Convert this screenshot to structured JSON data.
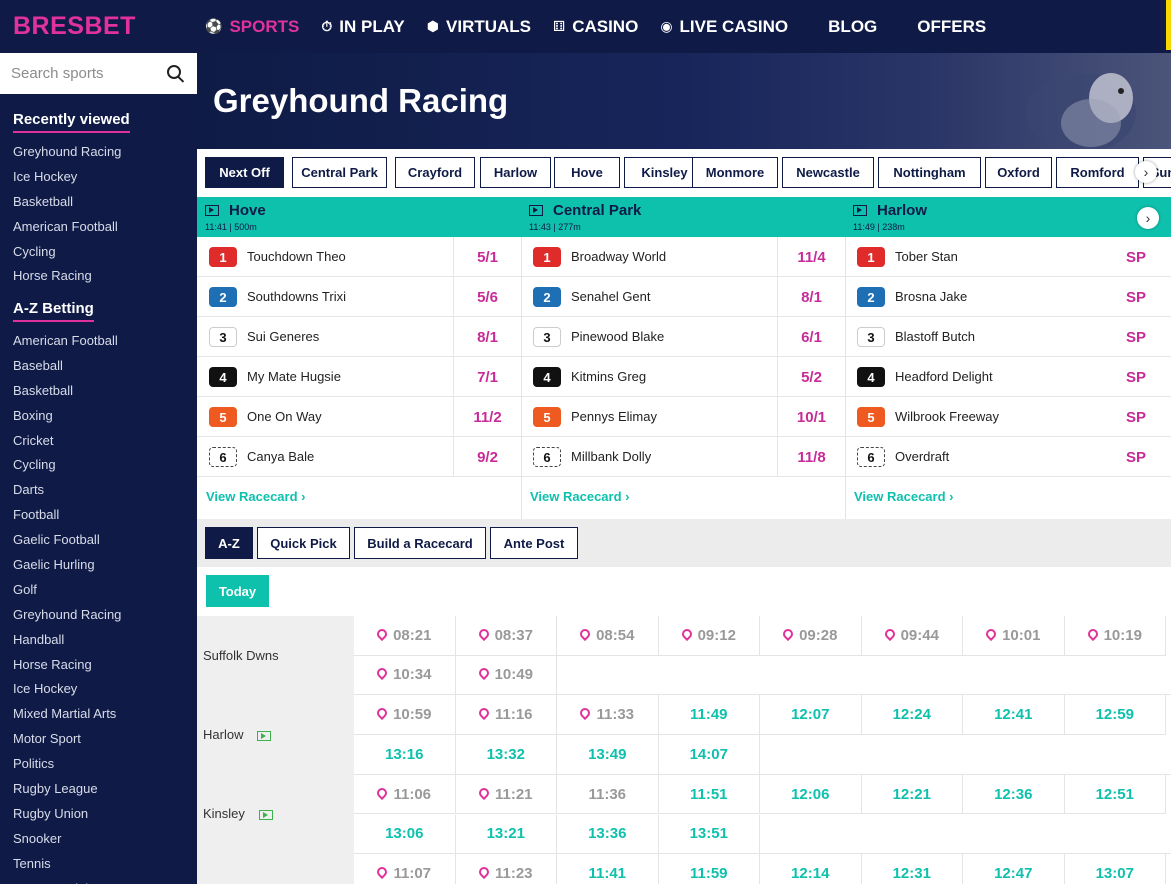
{
  "brand": {
    "logo": "BRESBET",
    "accent": "#e0329a",
    "navy": "#0f1b46",
    "teal": "#0ec1ad"
  },
  "nav": [
    {
      "label": "SPORTS",
      "icon": "sports-icon",
      "active": true
    },
    {
      "label": "IN PLAY",
      "icon": "stopwatch-icon"
    },
    {
      "label": "VIRTUALS",
      "icon": "cube-icon"
    },
    {
      "label": "CASINO",
      "icon": "dice-icon"
    },
    {
      "label": "LIVE CASINO",
      "icon": "chip-icon"
    },
    {
      "label": "BLOG"
    },
    {
      "label": "OFFERS"
    }
  ],
  "sidebar": {
    "search_placeholder": "Search sports",
    "recent_title": "Recently viewed",
    "recent": [
      "Greyhound Racing",
      "Ice Hockey",
      "Basketball",
      "American Football",
      "Cycling",
      "Horse Racing"
    ],
    "az_title": "A-Z Betting",
    "az": [
      "American Football",
      "Baseball",
      "Basketball",
      "Boxing",
      "Cricket",
      "Cycling",
      "Darts",
      "Football",
      "Gaelic Football",
      "Gaelic Hurling",
      "Golf",
      "Greyhound Racing",
      "Handball",
      "Horse Racing",
      "Ice Hockey",
      "Mixed Martial Arts",
      "Motor Sport",
      "Politics",
      "Rugby League",
      "Rugby Union",
      "Snooker",
      "Tennis",
      "TV & Specials"
    ]
  },
  "page": {
    "title": "Greyhound Racing"
  },
  "meeting_tabs": [
    "Next Off",
    "Central Park",
    "Crayford",
    "Harlow",
    "Hove",
    "Kinsley",
    "Monmore",
    "Newcastle",
    "Nottingham",
    "Oxford",
    "Romford",
    "Sun"
  ],
  "races": [
    {
      "venue": "Hove",
      "sub": "11:41 | 500m",
      "runners": [
        {
          "trap": "1",
          "name": "Touchdown Theo",
          "odds": "5/1"
        },
        {
          "trap": "2",
          "name": "Southdowns Trixi",
          "odds": "5/6"
        },
        {
          "trap": "3",
          "name": "Sui Generes",
          "odds": "8/1"
        },
        {
          "trap": "4",
          "name": "My Mate Hugsie",
          "odds": "7/1"
        },
        {
          "trap": "5",
          "name": "One On Way",
          "odds": "11/2"
        },
        {
          "trap": "6",
          "name": "Canya Bale",
          "odds": "9/2"
        }
      ]
    },
    {
      "venue": "Central Park",
      "sub": "11:43 | 277m",
      "runners": [
        {
          "trap": "1",
          "name": "Broadway World",
          "odds": "11/4"
        },
        {
          "trap": "2",
          "name": "Senahel Gent",
          "odds": "8/1"
        },
        {
          "trap": "3",
          "name": "Pinewood Blake",
          "odds": "6/1"
        },
        {
          "trap": "4",
          "name": "Kitmins Greg",
          "odds": "5/2"
        },
        {
          "trap": "5",
          "name": "Pennys Elimay",
          "odds": "10/1"
        },
        {
          "trap": "6",
          "name": "Millbank Dolly",
          "odds": "11/8"
        }
      ]
    },
    {
      "venue": "Harlow",
      "sub": "11:49 | 238m",
      "runners": [
        {
          "trap": "1",
          "name": "Tober Stan",
          "odds": "SP"
        },
        {
          "trap": "2",
          "name": "Brosna Jake",
          "odds": "SP"
        },
        {
          "trap": "3",
          "name": "Blastoff Butch",
          "odds": "SP"
        },
        {
          "trap": "4",
          "name": "Headford Delight",
          "odds": "SP"
        },
        {
          "trap": "5",
          "name": "Wilbrook Freeway",
          "odds": "SP"
        },
        {
          "trap": "6",
          "name": "Overdraft",
          "odds": "SP"
        }
      ]
    }
  ],
  "view_racecard": "View Racecard",
  "subtabs": [
    "A-Z",
    "Quick Pick",
    "Build a Racecard",
    "Ante Post"
  ],
  "today": "Today",
  "schedule": [
    {
      "venue": "Suffolk Dwns",
      "tv": false,
      "times": [
        {
          "t": "08:21",
          "s": "past"
        },
        {
          "t": "08:37",
          "s": "past"
        },
        {
          "t": "08:54",
          "s": "past"
        },
        {
          "t": "09:12",
          "s": "past"
        },
        {
          "t": "09:28",
          "s": "past"
        },
        {
          "t": "09:44",
          "s": "past"
        },
        {
          "t": "10:01",
          "s": "past"
        },
        {
          "t": "10:19",
          "s": "past"
        },
        {
          "t": "10:34",
          "s": "past"
        },
        {
          "t": "10:49",
          "s": "past"
        }
      ]
    },
    {
      "venue": "Harlow",
      "tv": true,
      "times": [
        {
          "t": "10:59",
          "s": "past"
        },
        {
          "t": "11:16",
          "s": "past"
        },
        {
          "t": "11:33",
          "s": "past"
        },
        {
          "t": "11:49",
          "s": "live"
        },
        {
          "t": "12:07",
          "s": "live"
        },
        {
          "t": "12:24",
          "s": "live"
        },
        {
          "t": "12:41",
          "s": "live"
        },
        {
          "t": "12:59",
          "s": "live"
        },
        {
          "t": "13:16",
          "s": "live"
        },
        {
          "t": "13:32",
          "s": "live"
        },
        {
          "t": "13:49",
          "s": "live"
        },
        {
          "t": "14:07",
          "s": "live"
        }
      ]
    },
    {
      "venue": "Kinsley",
      "tv": true,
      "times": [
        {
          "t": "11:06",
          "s": "past"
        },
        {
          "t": "11:21",
          "s": "past"
        },
        {
          "t": "11:36",
          "s": "plain"
        },
        {
          "t": "11:51",
          "s": "live"
        },
        {
          "t": "12:06",
          "s": "live"
        },
        {
          "t": "12:21",
          "s": "live"
        },
        {
          "t": "12:36",
          "s": "live"
        },
        {
          "t": "12:51",
          "s": "live"
        },
        {
          "t": "13:06",
          "s": "live"
        },
        {
          "t": "13:21",
          "s": "live"
        },
        {
          "t": "13:36",
          "s": "live"
        },
        {
          "t": "13:51",
          "s": "live"
        }
      ]
    },
    {
      "venue": "",
      "tv": false,
      "times": [
        {
          "t": "11:07",
          "s": "past"
        },
        {
          "t": "11:23",
          "s": "past"
        },
        {
          "t": "11:41",
          "s": "live"
        },
        {
          "t": "11:59",
          "s": "live"
        },
        {
          "t": "12:14",
          "s": "live"
        },
        {
          "t": "12:31",
          "s": "live"
        },
        {
          "t": "12:47",
          "s": "live"
        },
        {
          "t": "13:07",
          "s": "live"
        }
      ]
    }
  ]
}
